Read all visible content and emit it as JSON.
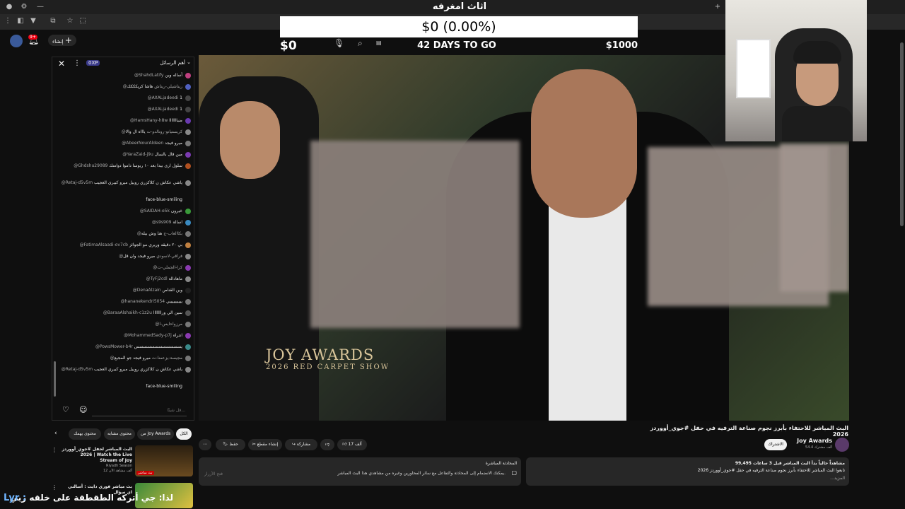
{
  "window": {
    "title": "اثاث امغرفه"
  },
  "goal": {
    "current": "$0 (0.00%)",
    "min": "$0",
    "days_left": "42 DAYS TO GO",
    "max": "$1000"
  },
  "toolbar": {
    "create_label": "إنشاء",
    "notif_count": "9+"
  },
  "video": {
    "logo_title": "JOY AWARDS",
    "logo_sub": "2026 RED CARPET SHOW"
  },
  "chat": {
    "header_label": "أهم الرسائل",
    "points": "0XP",
    "messages": [
      {
        "name": "@ShahdLatify",
        "text": "أساله وين",
        "color": "#c04080"
      },
      {
        "name": "@ريناشيلي-ريناش",
        "text": "هاشا كريكككك",
        "color": "#5060c0"
      },
      {
        "name": "@AXALjadeedi",
        "text": "1",
        "color": "#444"
      },
      {
        "name": "@AXALjadeedi",
        "text": "1",
        "color": "#444"
      },
      {
        "name": "@HamsHany-h8w",
        "text": "ضبااااااا",
        "color": "#6a3ab0"
      },
      {
        "name": "@كريستيانو-رونالدو-ت",
        "text": "ياااه ال والا",
        "color": "#888"
      },
      {
        "name": "@AbeerNourAldeen",
        "text": "ميرو فيجد",
        "color": "#777"
      },
      {
        "name": "@YaraZaid-j9u",
        "text": "مين قال بالسال",
        "color": "#7a3ab0"
      },
      {
        "name": "@Ghdshu29089",
        "text": "سلول ارى بيدا بعد ١٠ ربوسا داموا دوامنك",
        "color": "#b05020"
      },
      {
        "name": "@Retaj-d5v5m",
        "text": "ياشي عكاش ن كلاكزري روبيل ميرو كبيري العجيب",
        "color": "#888"
      },
      {
        "name": "",
        "text": "face-blue-smiling",
        "color": ""
      },
      {
        "name": "@SAIDAH-e5k",
        "text": "خيرون",
        "color": "#3a9a3a"
      },
      {
        "name": "@s9s909",
        "text": "اسالة",
        "color": "#3a8ac0"
      },
      {
        "name": "@بكاالعاب-ج",
        "text": "هنا وش بيله",
        "color": "#777"
      },
      {
        "name": "@FatimaAlsaadi-ov7cb",
        "text": "بي ٢٠ دقيقه وريري مو الجوائز",
        "color": "#c08040"
      },
      {
        "name": "@فراقي-لاسودي",
        "text": "ميرو فيجد وان قل",
        "color": "#888"
      },
      {
        "name": "@كرا-الجملي-ت",
        "text": "",
        "color": "#8a3ab0"
      },
      {
        "name": "@TyFj2cdl",
        "text": "ماهادالة",
        "color": "#888"
      },
      {
        "name": "@DenaAlzain",
        "text": "وين القناص",
        "color": "#222"
      },
      {
        "name": "@hananekendri5054",
        "text": "ييييييييييي",
        "color": "#777"
      },
      {
        "name": "@BaraaAlshaikh-c1z2u",
        "text": "سين الي ورااااااا",
        "color": "#555"
      },
      {
        "name": "@مرزواحايس-ا",
        "text": "",
        "color": "#777"
      },
      {
        "name": "@MohammedSady-p7j",
        "text": "انتراه",
        "color": "#8a3ab0"
      },
      {
        "name": "@PowsMower-b4r",
        "text": "يسسسسسسسسسسسس",
        "color": "#3a8a8a"
      },
      {
        "name": "@مجيسة-يزعمنا-ت",
        "text": "ميرو فيجد جو المجيع",
        "color": "#777"
      },
      {
        "name": "@Retaj-d5v5m",
        "text": "ياشي عكاش ن كلاكزري روبيل ميرو كبيري العجيب",
        "color": "#888"
      },
      {
        "name": "",
        "text": "face-blue-smiling",
        "color": ""
      }
    ],
    "input_placeholder": "قل شيئًا..."
  },
  "recommended": {
    "tabs": [
      "الكل",
      "من Joy Awards",
      "محتوى مشابه",
      "محتوى يهمك"
    ],
    "items": [
      {
        "title": "البث المباشر لحفل #جوي_أووردز 2026 | Watch the Live Stream of Joy",
        "channel": "Riyadh Season",
        "meta": "12 ألف مشاهد الآن",
        "badge": "بث مباشر"
      },
      {
        "title": "بث مباشر فوري دايت : أسالني اي سؤال",
        "channel": "",
        "meta": "",
        "badge": ""
      }
    ]
  },
  "video_info": {
    "title": "البث المباشر للاحتفاء بأبرز نجوم صناعة الترفيه في حفل #جوي_أووردز 2026",
    "channel": "Joy Awards",
    "subscribers": "54.4 ألف مشترك",
    "subscribe_label": "الاشتراك",
    "likes": "17 ألف",
    "share": "مشاركة",
    "clip": "إنشاء مقطع",
    "save": "حفظ",
    "desc_stats": "99,495 مشاهداً حالياً بدأ البث المباشر قبل 3 ساعات",
    "desc_text": "تابعوا البث المباشر للاحتفاء بأبرز نجوم صناعة الترفيه في حفل #جوي_أووردز 2026",
    "desc_more": "...المزيد",
    "live_chat_title": "المحادثة المباشرة",
    "live_chat_text": "يمكنك الانضمام إلى المحادثة والتفاعل مع سائر المحاورين وغيره من مشاهدي هذا البث المباشر.",
    "live_chat_btn": "فتح الأزرار"
  },
  "ticker": {
    "prefix": "Lyr :",
    "text": "لذا: جي أتركه الطقطقة على خلقه ربي"
  },
  "icons": [
    "mic-icon",
    "search-icon",
    "close-icon",
    "like-icon",
    "dislike-icon",
    "share-icon",
    "scissors-icon",
    "bookmark-icon",
    "more-icon",
    "heart-icon",
    "emoji-icon",
    "plus-icon",
    "bell-icon",
    "chevron-down-icon",
    "chevron-left-icon"
  ]
}
